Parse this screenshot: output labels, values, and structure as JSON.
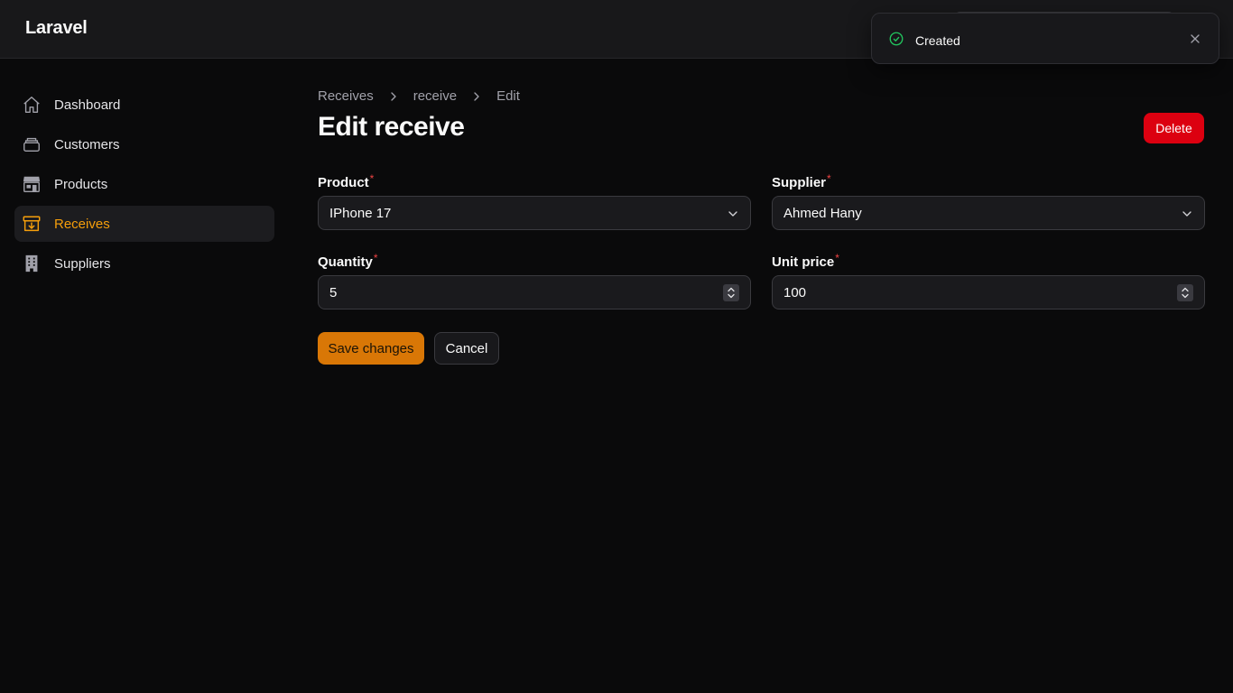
{
  "app": {
    "brand": "Laravel"
  },
  "toast": {
    "title": "Created",
    "icon": "check-circle-icon",
    "icon_color": "#22c55e"
  },
  "sidebar": {
    "items": [
      {
        "label": "Dashboard",
        "icon": "home-icon",
        "active": false
      },
      {
        "label": "Customers",
        "icon": "stack-icon",
        "active": false
      },
      {
        "label": "Products",
        "icon": "store-icon",
        "active": false
      },
      {
        "label": "Receives",
        "icon": "archive-download-icon",
        "active": true
      },
      {
        "label": "Suppliers",
        "icon": "building-icon",
        "active": false
      }
    ]
  },
  "breadcrumb": {
    "items": [
      "Receives",
      "receive",
      "Edit"
    ]
  },
  "page": {
    "title": "Edit receive",
    "delete_label": "Delete"
  },
  "form": {
    "product": {
      "label": "Product",
      "value": "IPhone 17"
    },
    "supplier": {
      "label": "Supplier",
      "value": "Ahmed Hany"
    },
    "quantity": {
      "label": "Quantity",
      "value": "5"
    },
    "unit_price": {
      "label": "Unit price",
      "value": "100"
    },
    "required_mark": "*",
    "save_label": "Save changes",
    "cancel_label": "Cancel"
  },
  "colors": {
    "accent": "#f59e0b",
    "danger": "#dc0010",
    "primary_button": "#d97706"
  }
}
